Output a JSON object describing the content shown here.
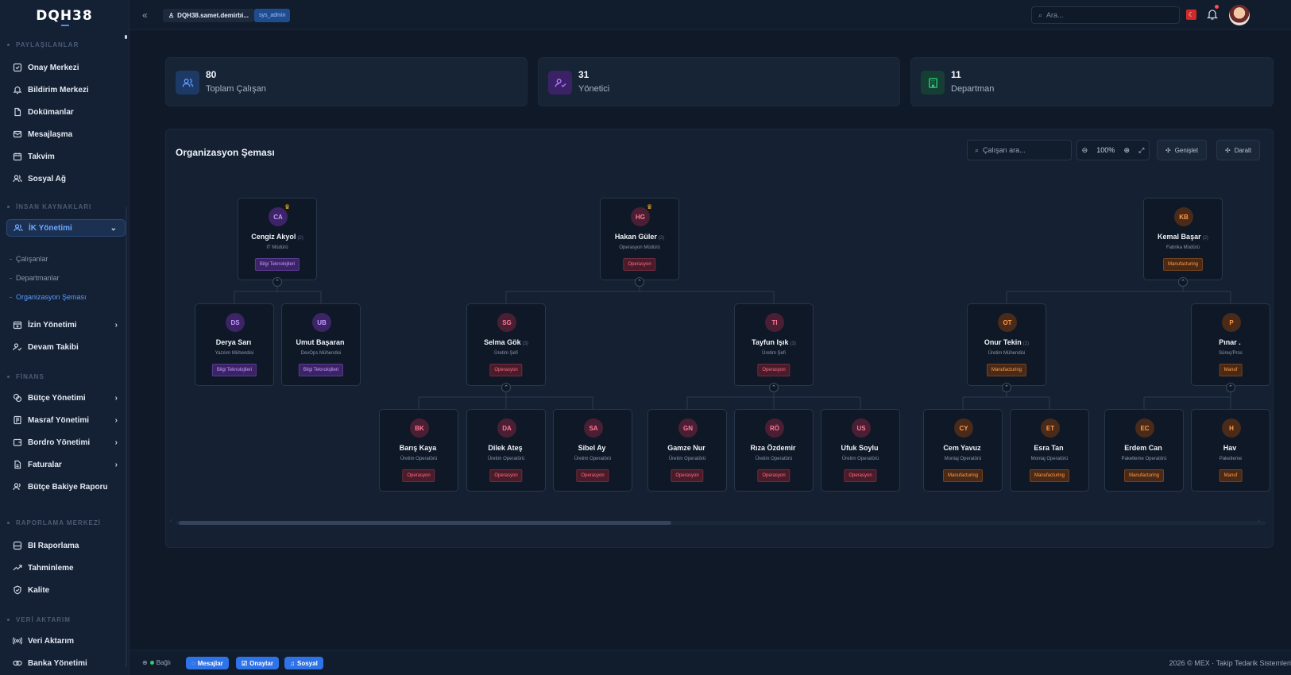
{
  "app": {
    "logo": "DQH38",
    "user_label": "DQH38.samet.demirbi...",
    "role": "sys_admin",
    "search_placeholder": "Ara..."
  },
  "sidebar": {
    "sections": [
      {
        "title": "PAYLAŞILANLAR"
      },
      {
        "title": "İNSAN KAYNAKLARI"
      },
      {
        "title": "FİNANS"
      },
      {
        "title": "RAPORLAMA MERKEZİ"
      },
      {
        "title": "VERİ AKTARIM"
      }
    ],
    "items": [
      {
        "label": "Onay Merkezi",
        "icon": "approval-icon"
      },
      {
        "label": "Bildirim Merkezi",
        "icon": "bell-icon"
      },
      {
        "label": "Dokümanlar",
        "icon": "document-icon"
      },
      {
        "label": "Mesajlaşma",
        "icon": "mail-icon"
      },
      {
        "label": "Takvim",
        "icon": "calendar-icon"
      },
      {
        "label": "Sosyal Ağ",
        "icon": "users-icon"
      },
      {
        "label": "İK Yönetimi",
        "icon": "users-icon"
      },
      {
        "label": "İzin Yönetimi",
        "icon": "calendar-plus-icon"
      },
      {
        "label": "Devam Takibi",
        "icon": "user-check-icon"
      },
      {
        "label": "Bütçe Yönetimi",
        "icon": "coins-icon"
      },
      {
        "label": "Masraf Yönetimi",
        "icon": "receipt-icon"
      },
      {
        "label": "Bordro Yönetimi",
        "icon": "wallet-icon"
      },
      {
        "label": "Faturalar",
        "icon": "invoice-icon"
      },
      {
        "label": "Bütçe Bakiye Raporu",
        "icon": "users-icon"
      },
      {
        "label": "BI Raporlama",
        "icon": "database-icon"
      },
      {
        "label": "Tahminleme",
        "icon": "trend-icon"
      },
      {
        "label": "Kalite",
        "icon": "shield-icon"
      },
      {
        "label": "Veri Aktarım",
        "icon": "broadcast-icon"
      },
      {
        "label": "Banka Yönetimi",
        "icon": "bank-icon"
      }
    ],
    "subitems": [
      {
        "label": "Çalışanlar"
      },
      {
        "label": "Departmanlar"
      },
      {
        "label": "Organizasyon Şeması"
      }
    ]
  },
  "stats": [
    {
      "value": "80",
      "label": "Toplam Çalışan",
      "color": "#3b82f6"
    },
    {
      "value": "31",
      "label": "Yönetici",
      "color": "#a855f7"
    },
    {
      "value": "11",
      "label": "Departman",
      "color": "#22c55e"
    }
  ],
  "org": {
    "title": "Organizasyon Şeması",
    "search_placeholder": "Çalışan ara...",
    "zoom": "100%",
    "expand_label": "Genişlet",
    "collapse_label": "Daralt",
    "nodes": [
      {
        "initials": "CA",
        "name": "Cengiz Akyol",
        "count": "(2)",
        "title": "IT Müdürü",
        "dept": "Bilgi Teknolojileri",
        "theme": "purple",
        "crown": true
      },
      {
        "initials": "HG",
        "name": "Hakan Güler",
        "count": "(2)",
        "title": "Operasyon Müdürü",
        "dept": "Operasyon",
        "theme": "red",
        "crown": true
      },
      {
        "initials": "KB",
        "name": "Kemal Başar",
        "count": "(2)",
        "title": "Fabrika Müdürü",
        "dept": "Manufacturing",
        "theme": "orange",
        "crown": false
      },
      {
        "initials": "DS",
        "name": "Derya Sarı",
        "count": "",
        "title": "Yazılım Mühendisi",
        "dept": "Bilgi Teknolojileri",
        "theme": "purple",
        "crown": false
      },
      {
        "initials": "UB",
        "name": "Umut Başaran",
        "count": "",
        "title": "DevOps Mühendisi",
        "dept": "Bilgi Teknolojileri",
        "theme": "purple",
        "crown": false
      },
      {
        "initials": "SG",
        "name": "Selma Gök",
        "count": "(3)",
        "title": "Üretim Şefi",
        "dept": "Operasyon",
        "theme": "red",
        "crown": false
      },
      {
        "initials": "TI",
        "name": "Tayfun Işık",
        "count": "(3)",
        "title": "Üretim Şefi",
        "dept": "Operasyon",
        "theme": "red",
        "crown": false
      },
      {
        "initials": "OT",
        "name": "Onur Tekin",
        "count": "(2)",
        "title": "Üretim Mühendisi",
        "dept": "Manufacturing",
        "theme": "orange",
        "crown": false
      },
      {
        "initials": "P",
        "name": "Pınar .",
        "count": "",
        "title": "Süreç/Pros",
        "dept": "Manuf",
        "theme": "orange",
        "crown": false
      },
      {
        "initials": "BK",
        "name": "Barış Kaya",
        "count": "",
        "title": "Üretim Operatörü",
        "dept": "Operasyon",
        "theme": "red",
        "crown": false
      },
      {
        "initials": "DA",
        "name": "Dilek Ateş",
        "count": "",
        "title": "Üretim Operatörü",
        "dept": "Operasyon",
        "theme": "red",
        "crown": false
      },
      {
        "initials": "SA",
        "name": "Sibel Ay",
        "count": "",
        "title": "Üretim Operatörü",
        "dept": "Operasyon",
        "theme": "red",
        "crown": false
      },
      {
        "initials": "GN",
        "name": "Gamze Nur",
        "count": "",
        "title": "Üretim Operatörü",
        "dept": "Operasyon",
        "theme": "red",
        "crown": false
      },
      {
        "initials": "RÖ",
        "name": "Rıza Özdemir",
        "count": "",
        "title": "Üretim Operatörü",
        "dept": "Operasyon",
        "theme": "red",
        "crown": false
      },
      {
        "initials": "US",
        "name": "Ufuk Soylu",
        "count": "",
        "title": "Üretim Operatörü",
        "dept": "Operasyon",
        "theme": "red",
        "crown": false
      },
      {
        "initials": "CY",
        "name": "Cem Yavuz",
        "count": "",
        "title": "Montaj Operatörü",
        "dept": "Manufacturing",
        "theme": "orange",
        "crown": false
      },
      {
        "initials": "ET",
        "name": "Esra Tan",
        "count": "",
        "title": "Montaj Operatörü",
        "dept": "Manufacturing",
        "theme": "orange",
        "crown": false
      },
      {
        "initials": "EC",
        "name": "Erdem Can",
        "count": "",
        "title": "Paketleme Operatörü",
        "dept": "Manufacturing",
        "theme": "orange",
        "crown": false
      },
      {
        "initials": "H",
        "name": "Hav",
        "count": "",
        "title": "Paketleme",
        "dept": "Manuf",
        "theme": "orange",
        "crown": false
      }
    ]
  },
  "footer": {
    "status": "Bağlı",
    "buttons": [
      "Mesajlar",
      "Onaylar",
      "Sosyal"
    ],
    "copyright": "2026 © MEX · Takip Tedarik Sistemleri"
  }
}
